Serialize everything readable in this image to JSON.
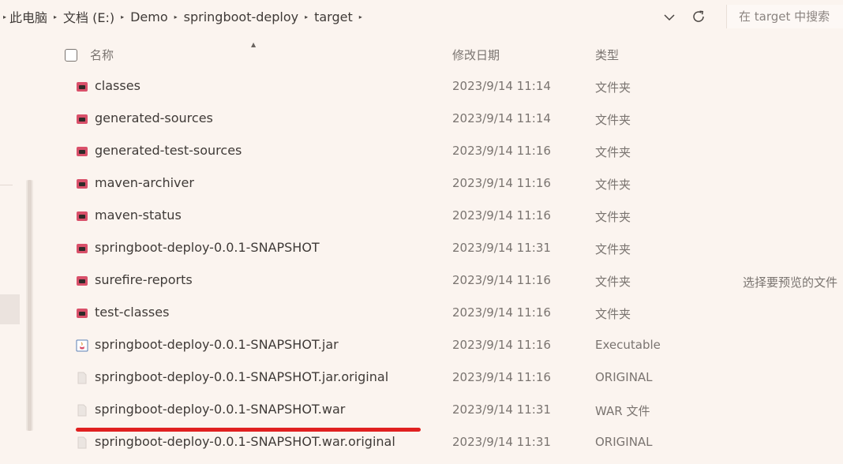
{
  "address_bar": {
    "breadcrumbs": [
      "此电脑",
      "文档 (E:)",
      "Demo",
      "springboot-deploy",
      "target"
    ],
    "search_placeholder": "在 target 中搜索"
  },
  "columns": {
    "name": "名称",
    "date": "修改日期",
    "type": "类型"
  },
  "files": [
    {
      "name": "classes",
      "date": "2023/9/14 11:14",
      "type": "文件夹",
      "icon": "folder-icon"
    },
    {
      "name": "generated-sources",
      "date": "2023/9/14 11:14",
      "type": "文件夹",
      "icon": "folder-icon"
    },
    {
      "name": "generated-test-sources",
      "date": "2023/9/14 11:16",
      "type": "文件夹",
      "icon": "folder-icon"
    },
    {
      "name": "maven-archiver",
      "date": "2023/9/14 11:16",
      "type": "文件夹",
      "icon": "folder-icon"
    },
    {
      "name": "maven-status",
      "date": "2023/9/14 11:16",
      "type": "文件夹",
      "icon": "folder-icon"
    },
    {
      "name": "springboot-deploy-0.0.1-SNAPSHOT",
      "date": "2023/9/14 11:31",
      "type": "文件夹",
      "icon": "folder-icon"
    },
    {
      "name": "surefire-reports",
      "date": "2023/9/14 11:16",
      "type": "文件夹",
      "icon": "folder-icon"
    },
    {
      "name": "test-classes",
      "date": "2023/9/14 11:16",
      "type": "文件夹",
      "icon": "folder-icon"
    },
    {
      "name": "springboot-deploy-0.0.1-SNAPSHOT.jar",
      "date": "2023/9/14 11:16",
      "type": "Executable",
      "icon": "jar-file-icon"
    },
    {
      "name": "springboot-deploy-0.0.1-SNAPSHOT.jar.original",
      "date": "2023/9/14 11:16",
      "type": "ORIGINAL",
      "icon": "generic-file-icon"
    },
    {
      "name": "springboot-deploy-0.0.1-SNAPSHOT.war",
      "date": "2023/9/14 11:31",
      "type": "WAR 文件",
      "icon": "generic-file-icon"
    },
    {
      "name": "springboot-deploy-0.0.1-SNAPSHOT.war.original",
      "date": "2023/9/14 11:31",
      "type": "ORIGINAL",
      "icon": "generic-file-icon"
    }
  ],
  "preview_pane": {
    "message": "选择要预览的文件"
  },
  "colors": {
    "background": "#fbf4ef",
    "folder": "#d9506a",
    "highlight_underline": "#e02020"
  }
}
